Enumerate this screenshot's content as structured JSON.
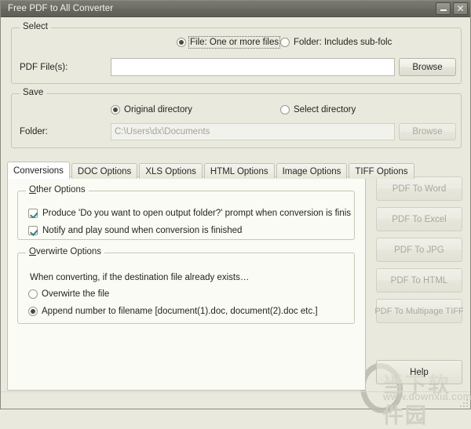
{
  "window": {
    "title": "Free PDF to All Converter",
    "minimize_label": "–",
    "close_label": "✕"
  },
  "select_group": {
    "title": "Select",
    "file_radio_label": "File:  One or more files",
    "folder_radio_label": "Folder: Includes sub-folc",
    "file_radio_selected": true,
    "pdf_files_label": "PDF File(s):",
    "pdf_files_value": "",
    "pdf_files_placeholder": "",
    "browse_label": "Browse"
  },
  "save_group": {
    "title": "Save",
    "original_dir_label": "Original directory",
    "select_dir_label": "Select directory",
    "original_selected": true,
    "folder_label": "Folder:",
    "folder_value": "C:\\Users\\dx\\Documents",
    "browse_label": "Browse"
  },
  "tabs": [
    {
      "label": "Conversions",
      "active": true
    },
    {
      "label": "DOC Options",
      "active": false
    },
    {
      "label": "XLS Options",
      "active": false
    },
    {
      "label": "HTML Options",
      "active": false
    },
    {
      "label": "Image Options",
      "active": false
    },
    {
      "label": "TIFF Options",
      "active": false
    }
  ],
  "other_options": {
    "title_accel": "O",
    "title_rest": "ther Options",
    "checkbox_1": {
      "label": "Produce 'Do you want to open output folder?' prompt when conversion is finis",
      "checked": true
    },
    "checkbox_2": {
      "label": "Notify and play sound when conversion is finished",
      "checked": true
    }
  },
  "overwrite_options": {
    "title_accel": "O",
    "title_rest": "verwirte Options",
    "description": "When converting, if the destination file already exists…",
    "radio_1": {
      "label": "Overwirte the file",
      "selected": false
    },
    "radio_2": {
      "label": "Append number to filename  [document(1).doc, document(2).doc etc.]",
      "selected": true
    }
  },
  "action_buttons": [
    {
      "label": "PDF To Word",
      "disabled": true
    },
    {
      "label": "PDF To Excel",
      "disabled": true
    },
    {
      "label": "PDF To JPG",
      "disabled": true
    },
    {
      "label": "PDF To HTML",
      "disabled": true
    },
    {
      "label": "PDF To Multipage TIFF",
      "disabled": true
    }
  ],
  "help_button": {
    "label": "Help"
  },
  "watermark": {
    "text_cn": "当下软件园",
    "url": "www.downxia.com"
  }
}
